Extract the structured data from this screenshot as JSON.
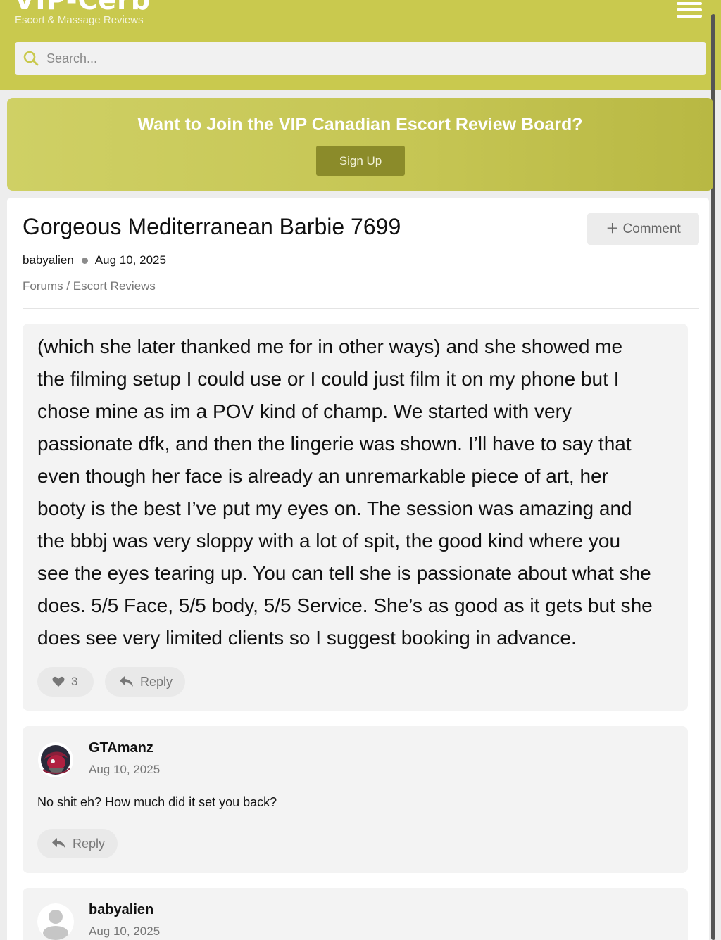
{
  "header": {
    "logo": "VIP-Cerb",
    "tagline": "Escort & Massage Reviews",
    "search_placeholder": "Search...",
    "accent_color": "#c9c94e"
  },
  "banner": {
    "title": "Want to Join the VIP Canadian Escort Review Board?",
    "signup_label": "Sign Up"
  },
  "thread": {
    "title": "Gorgeous Mediterranean Barbie 7699",
    "author": "babyalien",
    "date": "Aug 10, 2025",
    "breadcrumb": "Forums / Escort Reviews",
    "comment_label": "Comment"
  },
  "posts": [
    {
      "lines": [
        "(which she later thanked me for in other ways) and she showed me",
        "the filming setup I could use or I could just film it on my phone but I",
        "chose mine as im a POV kind of champ. We started with very",
        "passionate dfk, and then the lingerie was shown. I’ll have to say that",
        "even though her face is already an unremarkable piece of art, her",
        "booty is the best I’ve put my eyes on. The session was amazing and",
        "the bbbj was very sloppy with a lot of spit, the good kind where you",
        "see the eyes tearing up. You can tell she is passionate about what she",
        "does. 5/5 Face, 5/5 body, 5/5 Service. She’s as good as it gets but she",
        "does see very limited clients so I suggest booking in advance."
      ],
      "likes": "3",
      "reply_label": "Reply"
    },
    {
      "author": "GTAmanz",
      "date": "Aug 10, 2025",
      "text": "No shit eh? How much did it set you back?",
      "reply_label": "Reply",
      "avatar_icon": "raptors-logo-avatar"
    },
    {
      "author": "babyalien",
      "date": "Aug 10, 2025",
      "avatar_icon": "default-user-avatar"
    }
  ]
}
